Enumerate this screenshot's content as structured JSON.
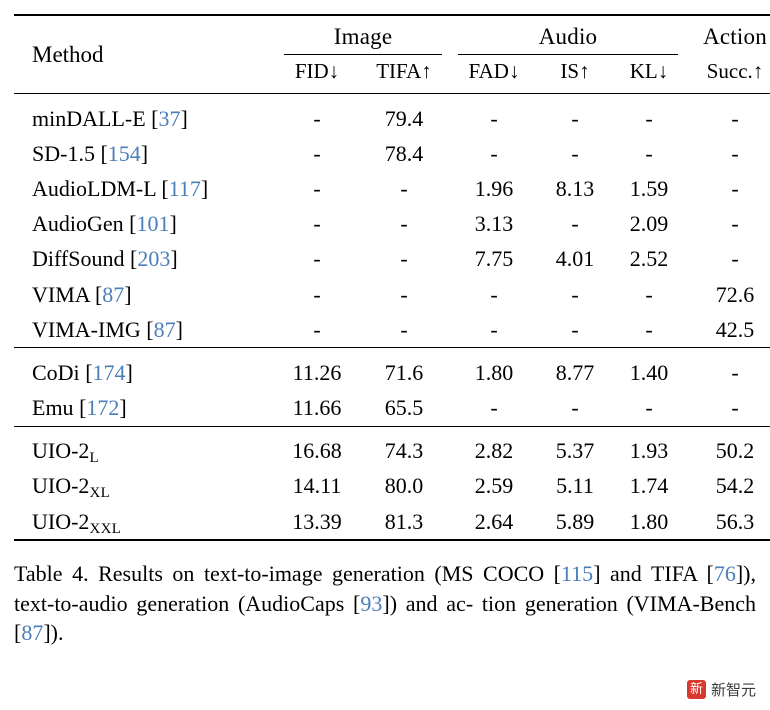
{
  "table": {
    "group_headers": [
      {
        "label": "Image",
        "span": 2
      },
      {
        "label": "Audio",
        "span": 3
      },
      {
        "label": "Action",
        "span": 1
      }
    ],
    "method_header": "Method",
    "sub_headers": [
      "FID↓",
      "TIFA↑",
      "FAD↓",
      "IS↑",
      "KL↓",
      "Succ.↑"
    ],
    "groups": [
      {
        "rows": [
          {
            "method": "minDALL-E",
            "cite": "37",
            "values": [
              "-",
              "79.4",
              "-",
              "-",
              "-",
              "-"
            ]
          },
          {
            "method": "SD-1.5",
            "cite": "154",
            "values": [
              "-",
              "78.4",
              "-",
              "-",
              "-",
              "-"
            ]
          },
          {
            "method": "AudioLDM-L",
            "cite": "117",
            "values": [
              "-",
              "-",
              "1.96",
              "8.13",
              "1.59",
              "-"
            ]
          },
          {
            "method": "AudioGen",
            "cite": "101",
            "values": [
              "-",
              "-",
              "3.13",
              "-",
              "2.09",
              "-"
            ]
          },
          {
            "method": "DiffSound",
            "cite": "203",
            "values": [
              "-",
              "-",
              "7.75",
              "4.01",
              "2.52",
              "-"
            ]
          },
          {
            "method": "VIMA",
            "cite": "87",
            "values": [
              "-",
              "-",
              "-",
              "-",
              "-",
              "72.6"
            ]
          },
          {
            "method": "VIMA-IMG",
            "cite": "87",
            "values": [
              "-",
              "-",
              "-",
              "-",
              "-",
              "42.5"
            ]
          }
        ]
      },
      {
        "rows": [
          {
            "method": "CoDi",
            "cite": "174",
            "values": [
              "11.26",
              "71.6",
              "1.80",
              "8.77",
              "1.40",
              "-"
            ]
          },
          {
            "method": "Emu",
            "cite": "172",
            "values": [
              "11.66",
              "65.5",
              "-",
              "-",
              "-",
              "-"
            ]
          }
        ]
      },
      {
        "rows": [
          {
            "method": "UIO-2",
            "sub": "L",
            "cite": "",
            "values": [
              "16.68",
              "74.3",
              "2.82",
              "5.37",
              "1.93",
              "50.2"
            ]
          },
          {
            "method": "UIO-2",
            "sub": "XL",
            "cite": "",
            "values": [
              "14.11",
              "80.0",
              "2.59",
              "5.11",
              "1.74",
              "54.2"
            ]
          },
          {
            "method": "UIO-2",
            "sub": "XXL",
            "cite": "",
            "values": [
              "13.39",
              "81.3",
              "2.64",
              "5.89",
              "1.80",
              "56.3"
            ]
          }
        ]
      }
    ]
  },
  "caption": {
    "p1": "Table 4.  Results on text-to-image generation (MS COCO [",
    "c1": "115",
    "p2": "] and TIFA [",
    "c2": "76",
    "p3": "]), text-to-audio generation (AudioCaps [",
    "c3": "93",
    "p4": "]) and ac-",
    "p5": "tion generation (VIMA-Bench [",
    "c4": "87",
    "p6": "])."
  },
  "watermark": {
    "logo_glyph": "新",
    "text": "新智元"
  }
}
